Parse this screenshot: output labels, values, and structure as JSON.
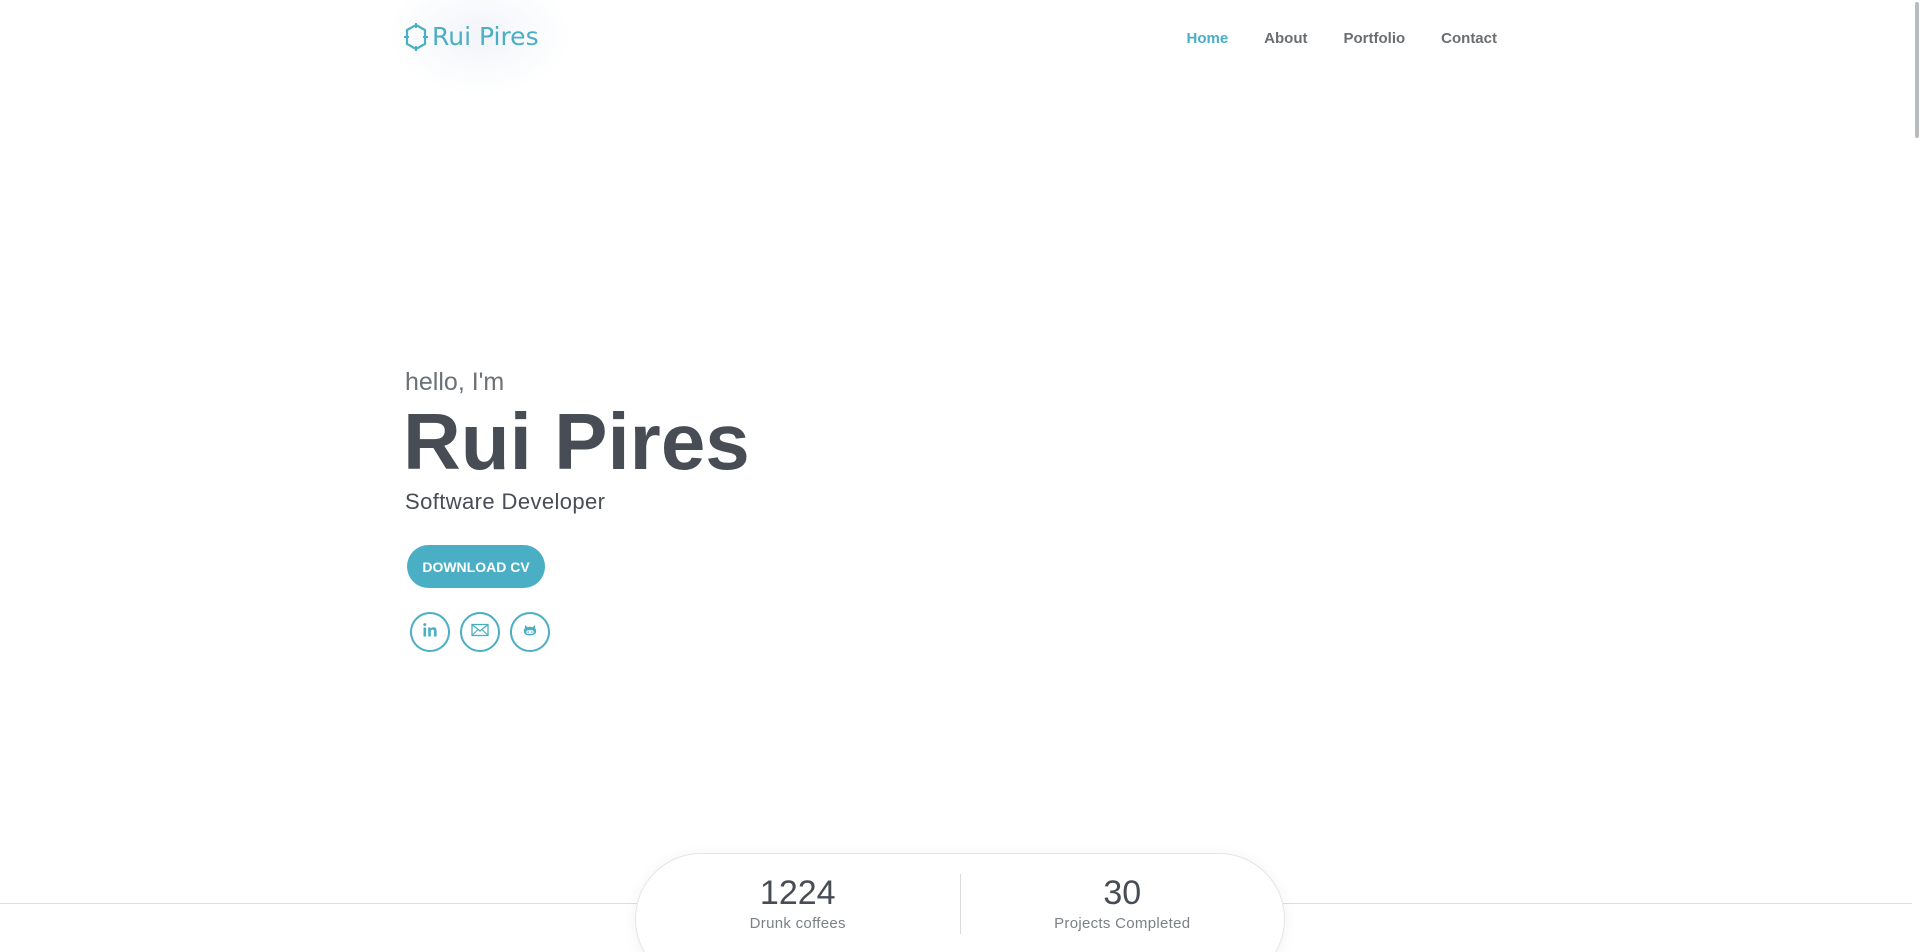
{
  "header": {
    "logo_text": "Rui Pires",
    "logo_icon": "hexagon-logo-icon",
    "nav": [
      {
        "label": "Home",
        "active": true
      },
      {
        "label": "About",
        "active": false
      },
      {
        "label": "Portfolio",
        "active": false
      },
      {
        "label": "Contact",
        "active": false
      }
    ]
  },
  "hero": {
    "greeting": "hello, I'm",
    "name": "Rui Pires",
    "role": "Software Developer",
    "cv_button": "DOWNLOAD CV",
    "socials": [
      {
        "icon": "linkedin-icon"
      },
      {
        "icon": "email-icon"
      },
      {
        "icon": "github-icon"
      }
    ]
  },
  "stats": [
    {
      "value": "1224",
      "label": "Drunk coffees"
    },
    {
      "value": "30",
      "label": "Projects Completed"
    }
  ],
  "colors": {
    "accent": "#4aaec4",
    "heading": "#474c55",
    "nav_text": "#6b6e70"
  }
}
